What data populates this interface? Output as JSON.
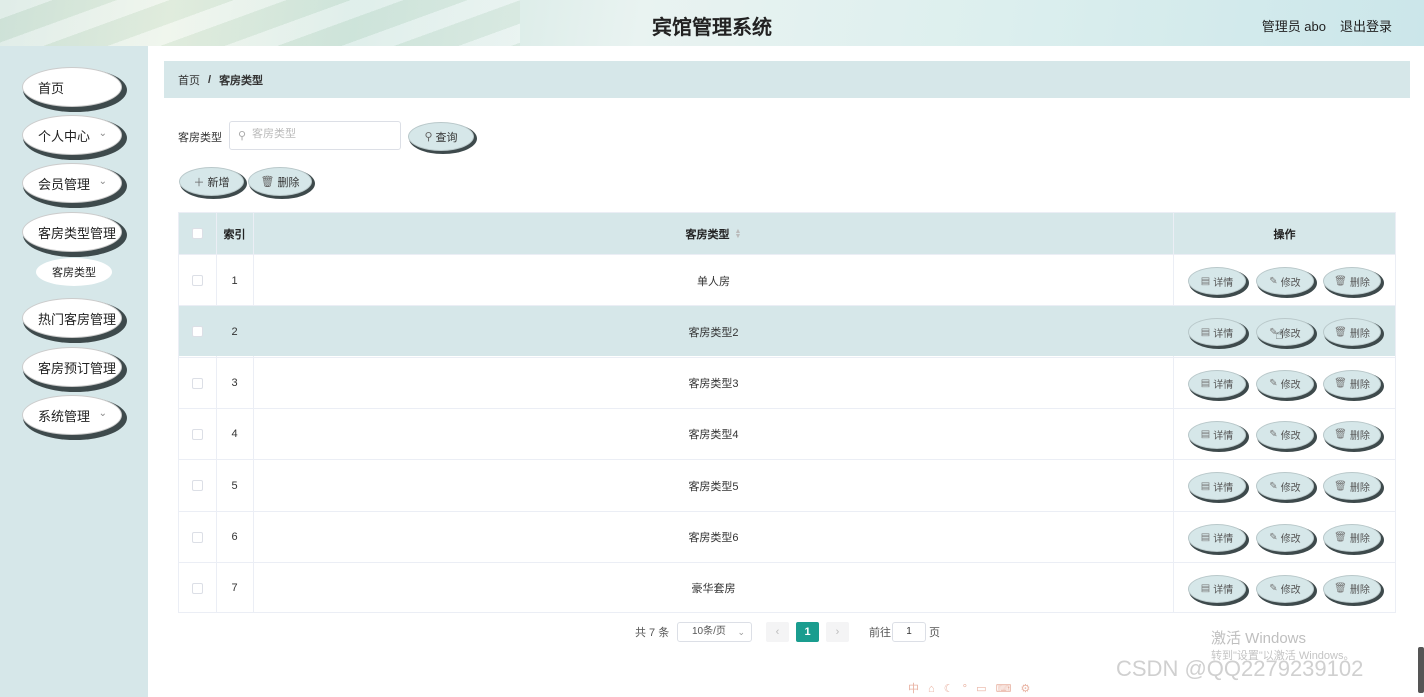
{
  "header": {
    "title": "宾馆管理系统",
    "admin": "管理员 abo",
    "logout": "退出登录"
  },
  "sidebar": {
    "items": [
      {
        "label": "首页",
        "has_arrow": false
      },
      {
        "label": "个人中心",
        "has_arrow": true
      },
      {
        "label": "会员管理",
        "has_arrow": true
      },
      {
        "label": "客房类型管理",
        "has_arrow": false
      },
      {
        "label": "热门客房管理",
        "has_arrow": false
      },
      {
        "label": "客房预订管理",
        "has_arrow": false
      },
      {
        "label": "系统管理",
        "has_arrow": true
      }
    ],
    "sub_item": "客房类型"
  },
  "breadcrumb": {
    "home": "首页",
    "sep": "/",
    "current": "客房类型"
  },
  "search": {
    "label": "客房类型",
    "placeholder": "客房类型",
    "value": "",
    "button": "查询",
    "icon": "search-icon"
  },
  "toolbar": {
    "add": "新增",
    "delete": "删除"
  },
  "table": {
    "headers": {
      "index": "索引",
      "type": "客房类型",
      "actions": "操作"
    },
    "rows": [
      {
        "index": "1",
        "type": "单人房"
      },
      {
        "index": "2",
        "type": "客房类型2"
      },
      {
        "index": "3",
        "type": "客房类型3"
      },
      {
        "index": "4",
        "type": "客房类型4"
      },
      {
        "index": "5",
        "type": "客房类型5"
      },
      {
        "index": "6",
        "type": "客房类型6"
      },
      {
        "index": "7",
        "type": "豪华套房"
      }
    ],
    "highlighted_row": 2,
    "actions": {
      "detail": "详情",
      "edit": "修改",
      "delete": "删除"
    }
  },
  "pagination": {
    "total": "共 7 条",
    "page_size": "10条/页",
    "current_page": "1",
    "goto_prefix": "前往",
    "goto_value": "1",
    "goto_suffix": "页"
  },
  "overlay": {
    "activate_title": "激活 Windows",
    "activate_sub": "转到\"设置\"以激活 Windows。",
    "csdn": "CSDN @QQ2279239102",
    "ime": "中 ⌂ ☾ ° ▭ ⌨ ⚙"
  },
  "colors": {
    "accent": "#d6e7e9",
    "page_active": "#1a9d8f",
    "pill_shadow": "#3e4a4c"
  }
}
